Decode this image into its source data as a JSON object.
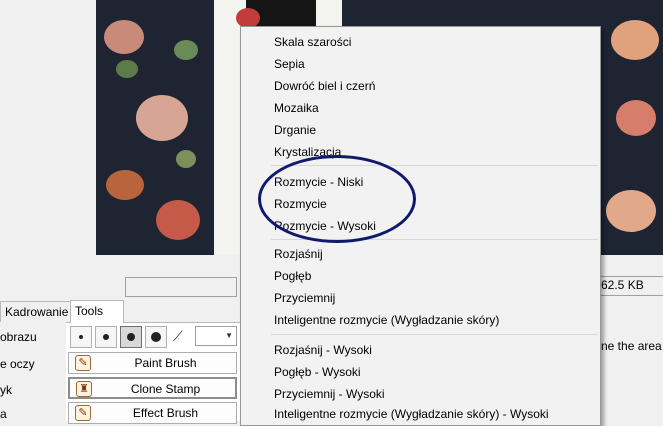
{
  "tabs": [
    {
      "label": "Kadrowanie",
      "active": false
    },
    {
      "label": "Tools",
      "active": true
    }
  ],
  "side_labels": [
    "obrazu",
    "e oczy",
    "yk",
    "a"
  ],
  "brush_buttons": [
    "brush-small",
    "brush-medium",
    "brush-large-selected",
    "brush-xlarge"
  ],
  "tools": [
    {
      "label": "Paint Brush",
      "icon": "paint-brush-icon"
    },
    {
      "label": "Clone Stamp",
      "icon": "clone-stamp-icon"
    },
    {
      "label": "Effect Brush",
      "icon": "effect-brush-icon"
    }
  ],
  "file_size": "62.5 KB",
  "right_hint": "ne the area",
  "context_menu": {
    "items": [
      {
        "label": "Skala szarości",
        "group": 0
      },
      {
        "label": "Sepia",
        "group": 0
      },
      {
        "label": "Dowróć biel i czerń",
        "group": 0
      },
      {
        "label": "Mozaika",
        "group": 0
      },
      {
        "label": "Drganie",
        "group": 0
      },
      {
        "label": "Krystalizacja",
        "group": 0
      },
      {
        "label": "Rozmycie - Niski",
        "group": 1
      },
      {
        "label": "Rozmycie",
        "group": 1
      },
      {
        "label": "Rozmycie - Wysoki",
        "group": 1
      },
      {
        "label": "Rozjaśnij",
        "group": 2
      },
      {
        "label": "Pogłęb",
        "group": 2
      },
      {
        "label": "Przyciemnij",
        "group": 2
      },
      {
        "label": "Inteligentne rozmycie (Wygładzanie skóry)",
        "group": 2
      },
      {
        "label": "Rozjaśnij - Wysoki",
        "group": 3
      },
      {
        "label": "Pogłęb - Wysoki",
        "group": 3
      },
      {
        "label": "Przyciemnij - Wysoki",
        "group": 3
      },
      {
        "label": "Inteligentne rozmycie (Wygładzanie skóry) - Wysoki",
        "group": 3
      }
    ]
  },
  "annotation_color": "#101a6c"
}
